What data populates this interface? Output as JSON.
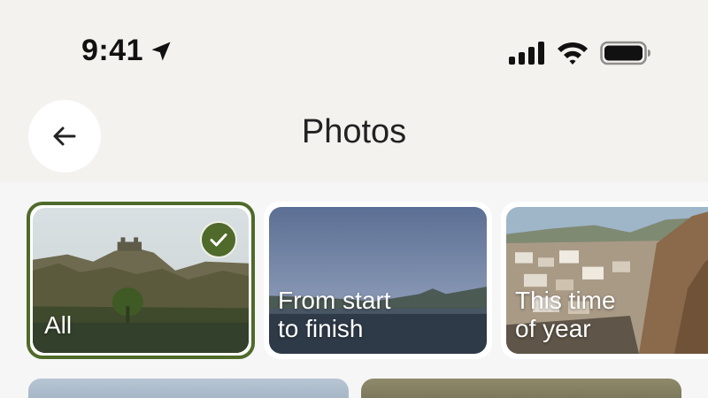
{
  "status_bar": {
    "time": "9:41",
    "location_icon": "location-arrow-icon",
    "signal_icon": "cellular-signal-icon",
    "wifi_icon": "wifi-icon",
    "battery_icon": "battery-full-icon"
  },
  "header": {
    "back_icon": "arrow-left-icon",
    "title": "Photos"
  },
  "albums": [
    {
      "label": "All",
      "selected": true
    },
    {
      "label": "From start\nto finish",
      "selected": false
    },
    {
      "label": "This time\nof year",
      "selected": false
    }
  ],
  "colors": {
    "background": "#f4f2ee",
    "accent": "#4f6a2a",
    "card_background": "#ffffff"
  }
}
